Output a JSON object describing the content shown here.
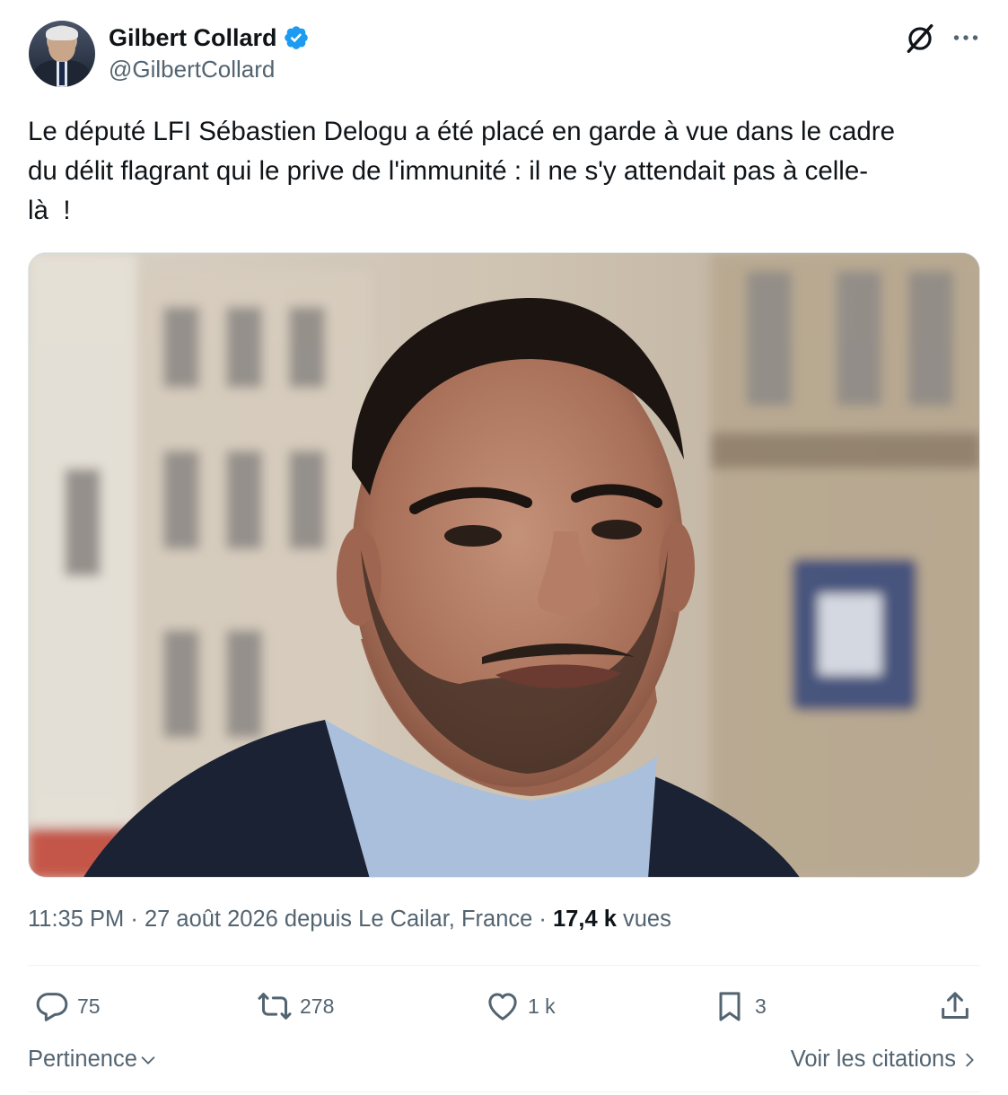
{
  "author": {
    "display_name": "Gilbert Collard",
    "handle": "@GilbertCollard",
    "verified_badge_color": "#1d9bf0"
  },
  "tweet": {
    "text": "Le député LFI Sébastien Delogu a été placé en garde à vue dans le cadre\ndu délit flagrant qui le prive de l'immunité : il ne s'y attendait pas à celle-\nlà  !"
  },
  "meta": {
    "time": "11:35 PM",
    "separator": " · ",
    "date_location": "27 août 2026 depuis Le Cailar, France",
    "views_count": "17,4 k",
    "views_label": "vues"
  },
  "actions": {
    "reply_count": "75",
    "retweet_count": "278",
    "like_count": "1 k",
    "bookmark_count": "3"
  },
  "footer": {
    "sort_label": "Pertinence",
    "quotes_label": "Voir les citations"
  },
  "icons": {
    "reply": "reply-icon",
    "retweet": "retweet-icon",
    "like": "heart-icon",
    "bookmark": "bookmark-icon",
    "share": "share-icon",
    "grok": "grok-icon",
    "more": "more-icon"
  },
  "colors": {
    "text_primary": "#0f1419",
    "text_secondary": "#536471",
    "accent": "#1d9bf0"
  }
}
